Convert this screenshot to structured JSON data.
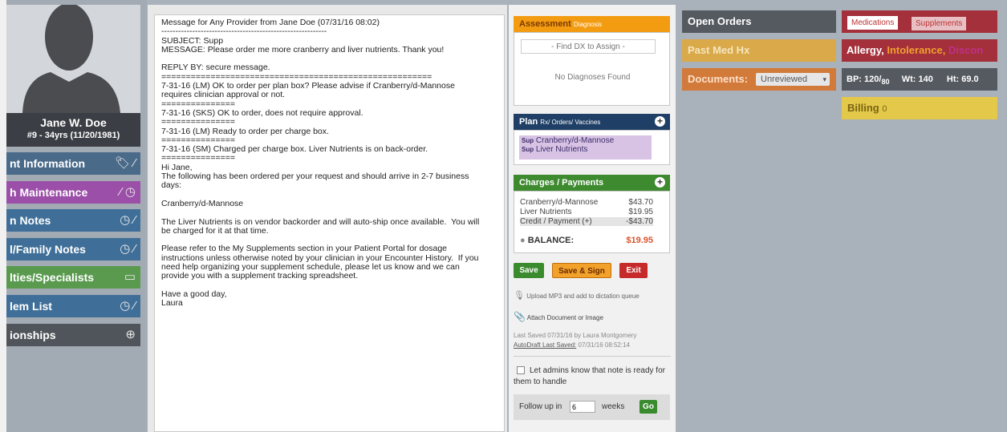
{
  "patient": {
    "name": "Jane W. Doe",
    "age": "#9 - 34yrs (11/20/1981)"
  },
  "nav": [
    {
      "label": "nt Information",
      "color": "#4a6a8a",
      "icons": "🏷 ⁄"
    },
    {
      "label": "h Maintenance",
      "color": "#9b4fa8",
      "icons": "⁄ ◷"
    },
    {
      "label": "n Notes",
      "color": "#3f6f98",
      "icons": "◷ ⁄"
    },
    {
      "label": "l/Family Notes",
      "color": "#3f6f98",
      "icons": "◷ ⁄"
    },
    {
      "label": "lties/Specialists",
      "color": "#5a9a4f",
      "icons": "▭"
    },
    {
      "label": "lem List",
      "color": "#3f6f98",
      "icons": "◷ ⁄"
    },
    {
      "label": "ionships",
      "color": "#50555b",
      "icons": "⊕"
    }
  ],
  "note": {
    "text": "Message for Any Provider from Jane Doe (07/31/16 08:02)\n-----------------------------------------------------------\nSUBJECT: Supp\nMESSAGE: Please order me more cranberry and liver nutrients. Thank you!\n\nREPLY BY: secure message.\n=======================================================\n7-31-16 (LM) OK to order per plan box? Please advise if Cranberry/d-Mannose\nrequires clinician approval or not.\n===============\n7-31-16 (SKS) OK to order, does not require approval.\n===============\n7-31-16 (LM) Ready to order per charge box.\n===============\n7-31-16 (SM) Charged per charge box. Liver Nutrients is on back-order.\n===============\nHi Jane,\nThe following has been ordered per your request and should arrive in 2-7 business\ndays:\n\nCranberry/d-Mannose\n\nThe Liver Nutrients is on vendor backorder and will auto-ship once available.  You will\nbe charged for it at that time.\n\nPlease refer to the My Supplements section in your Patient Portal for dosage\ninstructions unless otherwise noted by your clinician in your Encounter History.  If you\nneed help organizing your supplement schedule, please let us know and we can\nprovide you with a supplement tracking spreadsheet.\n\nHave a good day,\nLaura"
  },
  "assessment": {
    "title": "Assessment",
    "sub": "Diagnosis",
    "find_placeholder": "- Find DX to Assign -",
    "empty": "No Diagnoses Found"
  },
  "plan": {
    "title": "Plan",
    "sub": "Rx/ Orders/ Vaccines",
    "items": [
      {
        "tag": "Sup",
        "label": "Cranberry/d-Mannose"
      },
      {
        "tag": "Sup",
        "label": "Liver Nutrients"
      }
    ]
  },
  "charges": {
    "title": "Charges / Payments",
    "rows": [
      {
        "label": "Cranberry/d-Mannose",
        "amount": "$43.70"
      },
      {
        "label": "Liver Nutrients",
        "amount": "$19.95"
      },
      {
        "label": "Credit / Payment (+)",
        "amount": "-$43.70"
      }
    ],
    "balance_label": "BALANCE:",
    "balance": "$19.95"
  },
  "actions": {
    "save": "Save",
    "save_sign": "Save & Sign",
    "exit": "Exit"
  },
  "upload_text": "Upload MP3 and add to dictation queue",
  "attach_text": "Attach Document or Image",
  "last_saved": "Last Saved 07/31/16 by Laura Montgomery",
  "autodraft_label": "AutoDraft Last Saved:",
  "autodraft_time": "07/31/16 08:52:14",
  "admin_check": "Let admins know that note is ready for them to handle",
  "followup": {
    "prefix": "Follow up in",
    "value": "6",
    "unit": "weeks",
    "go": "Go"
  },
  "right": {
    "open_orders": "Open Orders",
    "past_med": "Past Med Hx",
    "documents": "Documents:",
    "documents_select": "Unreviewed",
    "med_tabs": [
      "Medications",
      "Supplements"
    ],
    "allergy": "Allergy,",
    "intolerance": "Intolerance,",
    "discon": "Discon",
    "bp_label": "BP:",
    "bp_sys": "120",
    "bp_dia": "80",
    "wt_label": "Wt:",
    "wt": "140",
    "ht_label": "Ht:",
    "ht": "69.0",
    "billing": "Billing",
    "billing_count": "0"
  }
}
